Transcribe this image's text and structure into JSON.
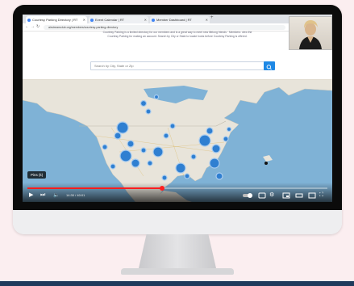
{
  "browser": {
    "tabs": [
      {
        "label": "Courtesy Parking Directory | RT"
      },
      {
        "label": "Event Calendar | RT"
      },
      {
        "label": "Member Dashboard | RT"
      }
    ],
    "new_tab_symbol": "+",
    "url": "airstreamclub.org/members/courtesy-parking-directory",
    "back_symbol": "←",
    "forward_symbol": "→",
    "reload_symbol": "↻"
  },
  "page": {
    "intro_line_1": "Courtesy Parking is a limited directory for our members and is a great way to meet new lifelong friends · Members: view the",
    "intro_line_2": "Courtesy Parking for making an account. Search by City or State to locate hosts before Courtesy Parking is offered.",
    "search_placeholder": "Search by City, State or Zip"
  },
  "player": {
    "tooltip": "Pins (k)",
    "time": "14:30 / 40:01",
    "progress_fraction": 0.45
  },
  "colors": {
    "accent_red": "#ff1e1e",
    "search_button": "#1e88e5",
    "map_cluster": "#2f7fd1",
    "bottom_band": "#1f3a5c",
    "background": "#fbeef0"
  },
  "icons": [
    "play-icon",
    "next-icon",
    "volume-icon",
    "autoplay-toggle-icon",
    "subtitles-icon",
    "settings-icon",
    "miniplayer-icon",
    "theater-icon",
    "fullscreen-icon",
    "search-icon"
  ]
}
